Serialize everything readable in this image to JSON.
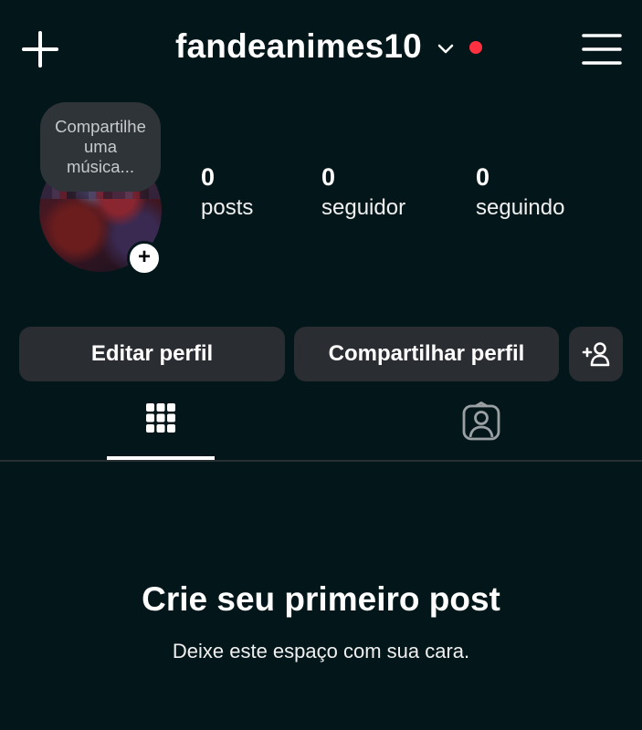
{
  "header": {
    "username": "fandeanimes10",
    "add_icon": "plus-icon",
    "dropdown_icon": "chevron-down-icon",
    "notification_dot_color": "#ff3040",
    "menu_icon": "hamburger-menu-icon"
  },
  "profile": {
    "note_text": "Compartilhe uma música...",
    "add_story_icon": "plus-icon",
    "stats": [
      {
        "value": "0",
        "label": "posts"
      },
      {
        "value": "0",
        "label": "seguidor"
      },
      {
        "value": "0",
        "label": "seguindo"
      }
    ]
  },
  "actions": {
    "edit_label": "Editar perfil",
    "share_label": "Compartilhar perfil",
    "add_person_icon": "add-person-icon"
  },
  "tabs": [
    {
      "icon": "grid-icon",
      "active": true
    },
    {
      "icon": "tagged-person-icon",
      "active": false
    }
  ],
  "empty_state": {
    "title": "Crie seu primeiro post",
    "subtitle": "Deixe este espaço com sua cara."
  },
  "colors": {
    "background": "#03171a",
    "button_bg": "#2a2d32",
    "note_bg": "#2e3437"
  }
}
